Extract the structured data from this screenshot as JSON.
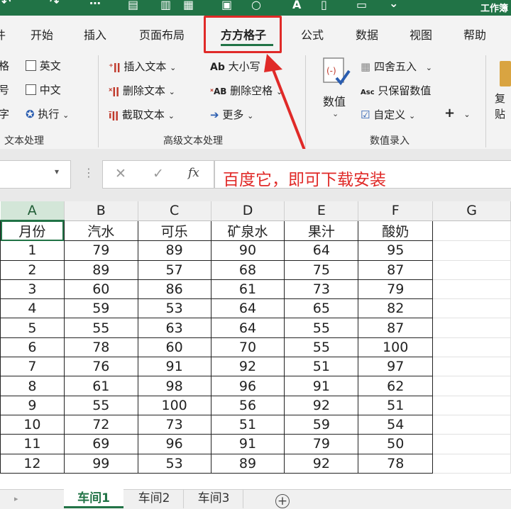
{
  "title_bar": {
    "workbook_title": "工作簿"
  },
  "ribbon_tabs": [
    {
      "label": "开始"
    },
    {
      "label": "插入"
    },
    {
      "label": "页面布局"
    },
    {
      "label": "方方格子",
      "active": true
    },
    {
      "label": "公式"
    },
    {
      "label": "数据"
    },
    {
      "label": "视图"
    },
    {
      "label": "帮助"
    }
  ],
  "ribbon": {
    "text_group": {
      "partial_labels": [
        "格",
        "号",
        "字"
      ],
      "english": "英文",
      "chinese": "中文",
      "execute": "执行",
      "group_label": "文本处理"
    },
    "advanced_text_group": {
      "insert_text": "插入文本",
      "delete_text": "删除文本",
      "extract_text": "截取文本",
      "case": "大小写",
      "case_icon_text": "Ab",
      "delete_spaces": "删除空格",
      "delete_spaces_icon_text": "AB",
      "more": "更多",
      "group_label": "高级文本处理"
    },
    "numeric_group": {
      "value": "数值",
      "round": "四舍五入",
      "keep_values": "只保留数值",
      "keep_values_icon_text": "Asc",
      "custom": "自定义",
      "plus": "+",
      "group_label": "数值录入"
    },
    "clipboard_partial": {
      "top": "复",
      "bottom": "贴"
    }
  },
  "formula_bar": {
    "fx": "fx",
    "cancel_symbol": "✕",
    "confirm_symbol": "✓",
    "annotation": "百度它，即可下载安装"
  },
  "sheet": {
    "columns": [
      "A",
      "B",
      "C",
      "D",
      "E",
      "F",
      "G"
    ],
    "selected_column": "A",
    "headers": [
      "月份",
      "汽水",
      "可乐",
      "矿泉水",
      "果汁",
      "酸奶"
    ],
    "rows": [
      [
        "1",
        "79",
        "89",
        "90",
        "64",
        "95"
      ],
      [
        "2",
        "89",
        "57",
        "68",
        "75",
        "87"
      ],
      [
        "3",
        "60",
        "86",
        "61",
        "73",
        "79"
      ],
      [
        "4",
        "59",
        "53",
        "64",
        "65",
        "82"
      ],
      [
        "5",
        "55",
        "63",
        "64",
        "55",
        "87"
      ],
      [
        "6",
        "78",
        "60",
        "70",
        "55",
        "100"
      ],
      [
        "7",
        "76",
        "91",
        "92",
        "51",
        "97"
      ],
      [
        "8",
        "61",
        "98",
        "96",
        "91",
        "62"
      ],
      [
        "9",
        "55",
        "100",
        "56",
        "92",
        "51"
      ],
      [
        "10",
        "72",
        "73",
        "51",
        "59",
        "54"
      ],
      [
        "11",
        "69",
        "96",
        "91",
        "79",
        "50"
      ],
      [
        "12",
        "99",
        "53",
        "89",
        "92",
        "78"
      ]
    ]
  },
  "sheet_tabs": [
    {
      "label": "车间1",
      "active": true
    },
    {
      "label": "车间2"
    },
    {
      "label": "车间3"
    }
  ],
  "colors": {
    "accent": "#217346",
    "annotation_red": "#e02a28"
  }
}
